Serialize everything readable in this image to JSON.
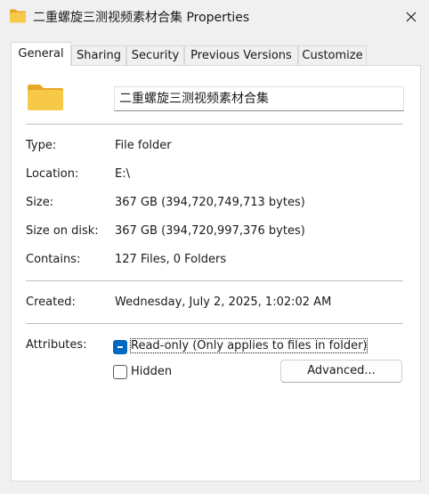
{
  "window": {
    "title": "二重螺旋三测视频素材合集 Properties",
    "close_glyph": "✕"
  },
  "tabs": [
    {
      "label": "General",
      "active": true
    },
    {
      "label": "Sharing",
      "active": false
    },
    {
      "label": "Security",
      "active": false
    },
    {
      "label": "Previous Versions",
      "active": false
    },
    {
      "label": "Customize",
      "active": false
    }
  ],
  "general": {
    "folder_name": "二重螺旋三测视频素材合集",
    "icon": "folder-icon",
    "rows": {
      "type": {
        "label": "Type:",
        "value": "File folder"
      },
      "location": {
        "label": "Location:",
        "value": "E:\\"
      },
      "size": {
        "label": "Size:",
        "value": "367 GB (394,720,749,713 bytes)"
      },
      "size_on_disk": {
        "label": "Size on disk:",
        "value": "367 GB (394,720,997,376 bytes)"
      },
      "contains": {
        "label": "Contains:",
        "value": "127 Files, 0 Folders"
      },
      "created": {
        "label": "Created:",
        "value": "Wednesday, July 2, 2025, 1:02:02 AM"
      }
    },
    "attributes": {
      "label": "Attributes:",
      "readonly": {
        "label": "Read-only (Only applies to files in folder)",
        "state": "indeterminate"
      },
      "hidden": {
        "label": "Hidden",
        "state": "unchecked"
      },
      "advanced_button": "Advanced..."
    }
  },
  "colors": {
    "accent": "#0067c0",
    "folder_body": "#f7c948",
    "folder_back": "#e8a825",
    "window_bg": "#f0f0f0",
    "panel_bg": "#ffffff"
  }
}
